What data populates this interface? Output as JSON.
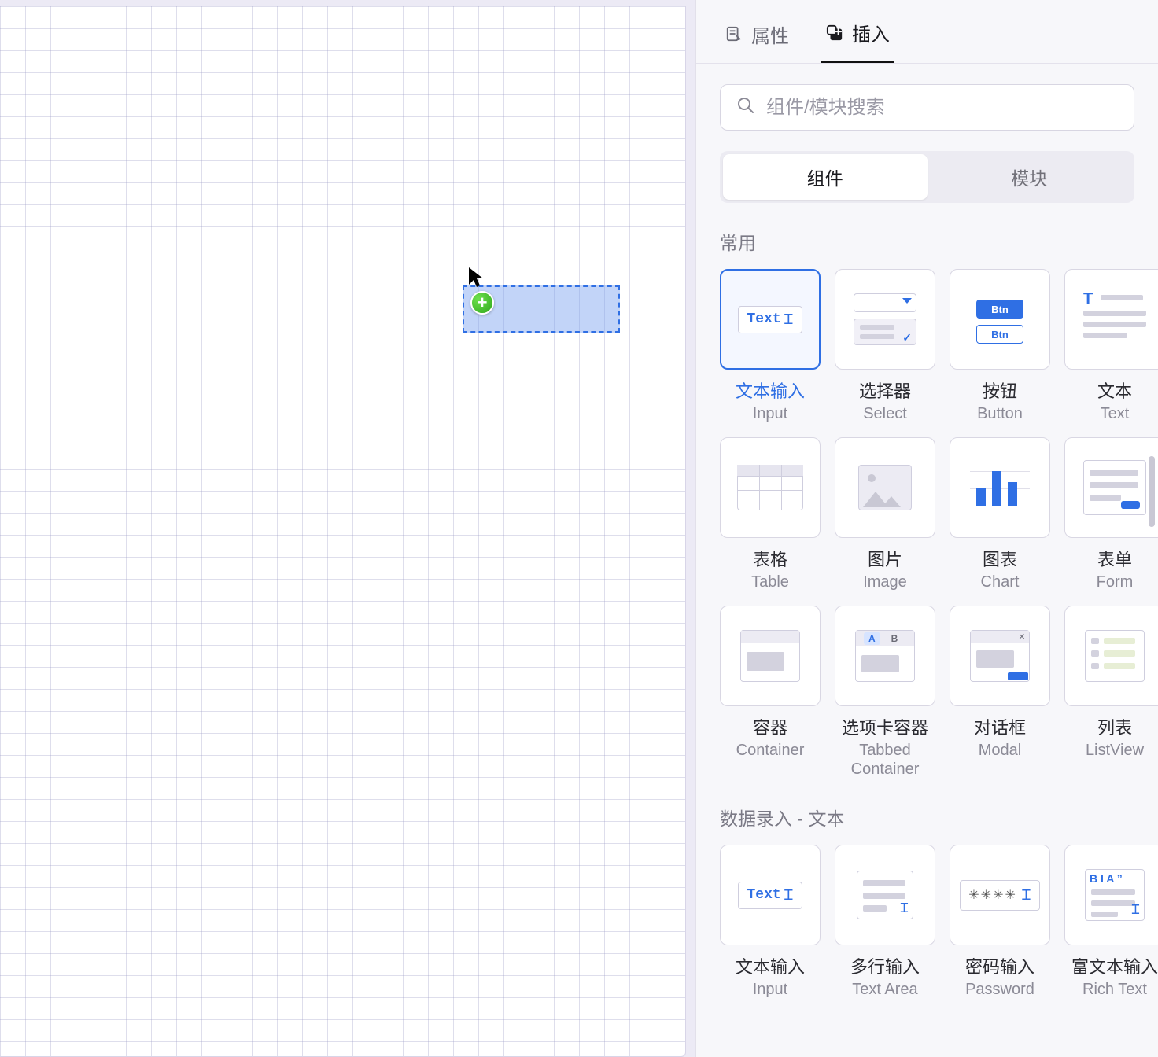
{
  "tabs": {
    "properties": "属性",
    "insert": "插入"
  },
  "search": {
    "placeholder": "组件/模块搜索"
  },
  "segmented": {
    "components": "组件",
    "modules": "模块"
  },
  "sections": {
    "common": {
      "title": "常用"
    },
    "data_text": {
      "title": "数据录入 - 文本"
    }
  },
  "components": {
    "input": {
      "cn": "文本输入",
      "en": "Input",
      "thumb_text": "Text"
    },
    "select": {
      "cn": "选择器",
      "en": "Select"
    },
    "button": {
      "cn": "按钮",
      "en": "Button",
      "thumb_text": "Btn"
    },
    "text": {
      "cn": "文本",
      "en": "Text",
      "thumb_text": "T"
    },
    "table": {
      "cn": "表格",
      "en": "Table"
    },
    "image": {
      "cn": "图片",
      "en": "Image"
    },
    "chart": {
      "cn": "图表",
      "en": "Chart"
    },
    "form": {
      "cn": "表单",
      "en": "Form"
    },
    "container": {
      "cn": "容器",
      "en": "Container"
    },
    "tabbed": {
      "cn": "选项卡容器",
      "en": "Tabbed Container",
      "thumb_a": "A",
      "thumb_b": "B"
    },
    "modal": {
      "cn": "对话框",
      "en": "Modal",
      "thumb_close": "×"
    },
    "listview": {
      "cn": "列表",
      "en": "ListView"
    },
    "input2": {
      "cn": "文本输入",
      "en": "Input",
      "thumb_text": "Text"
    },
    "textarea": {
      "cn": "多行输入",
      "en": "Text Area"
    },
    "password": {
      "cn": "密码输入",
      "en": "Password",
      "thumb_text": "✳✳✳✳"
    },
    "richtext": {
      "cn": "富文本输入",
      "en": "Rich Text",
      "thumb_text": "B I A ”"
    }
  }
}
